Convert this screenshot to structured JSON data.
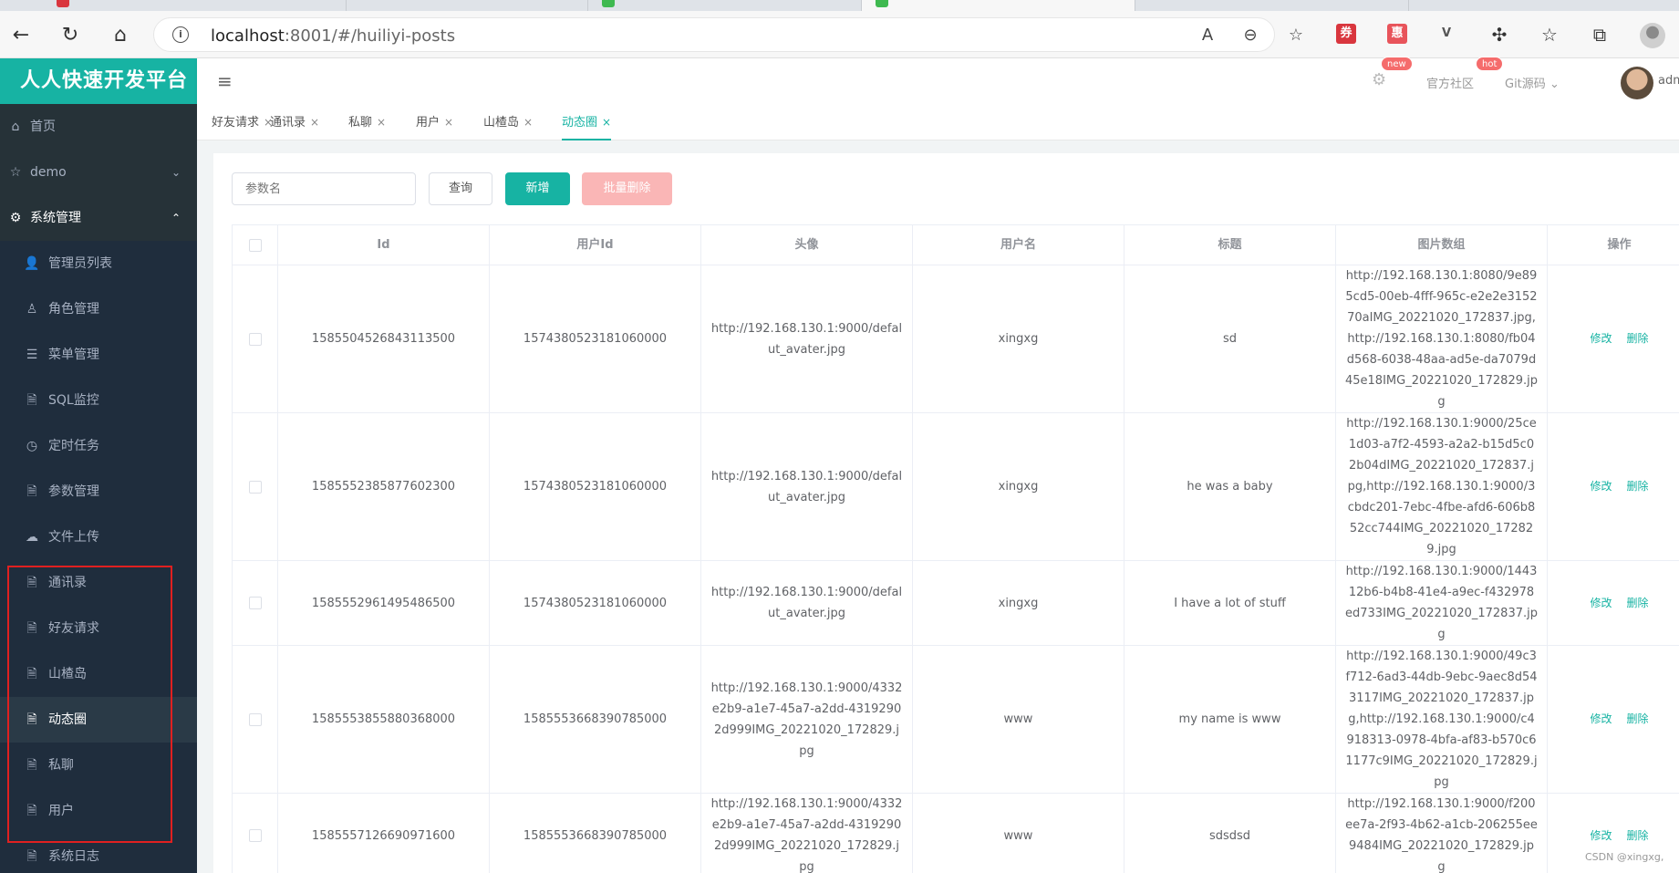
{
  "browser": {
    "url_host": "localhost",
    "url_rest": ":8001/#/huiliyi-posts",
    "read_aloud": "A",
    "ext_icons": [
      "券",
      "惠",
      "V"
    ]
  },
  "sidebar": {
    "brand": "人人快速开发平台",
    "items": [
      {
        "label": "首页",
        "icon": "home-icon",
        "glyph": "⌂"
      },
      {
        "label": "demo",
        "icon": "star-icon",
        "glyph": "☆",
        "arrow": "⌄"
      },
      {
        "label": "系统管理",
        "icon": "gear-icon",
        "glyph": "⚙",
        "arrow": "⌃"
      }
    ],
    "sub_items": [
      {
        "label": "管理员列表",
        "icon": "user-icon",
        "glyph": "👤"
      },
      {
        "label": "角色管理",
        "icon": "role-icon",
        "glyph": "♙"
      },
      {
        "label": "菜单管理",
        "icon": "list-icon",
        "glyph": "☰"
      },
      {
        "label": "SQL监控",
        "icon": "document-icon",
        "glyph": "🗎"
      },
      {
        "label": "定时任务",
        "icon": "clock-icon",
        "glyph": "◷"
      },
      {
        "label": "参数管理",
        "icon": "document-icon",
        "glyph": "🗎"
      },
      {
        "label": "文件上传",
        "icon": "cloud-icon",
        "glyph": "☁"
      },
      {
        "label": "通讯录",
        "icon": "document-icon",
        "glyph": "🗎"
      },
      {
        "label": "好友请求",
        "icon": "document-icon",
        "glyph": "🗎"
      },
      {
        "label": "山楂岛",
        "icon": "document-icon",
        "glyph": "🗎"
      },
      {
        "label": "动态圈",
        "icon": "document-icon",
        "glyph": "🗎",
        "active": true
      },
      {
        "label": "私聊",
        "icon": "document-icon",
        "glyph": "🗎"
      },
      {
        "label": "用户",
        "icon": "document-icon",
        "glyph": "🗎"
      },
      {
        "label": "系统日志",
        "icon": "document-icon",
        "glyph": "🗎"
      }
    ]
  },
  "header": {
    "badge_new": "new",
    "community": "官方社区",
    "badge_hot": "hot",
    "git": "Git源码",
    "username": "adm"
  },
  "tabs": [
    "好友请求",
    "通讯录",
    "私聊",
    "用户",
    "山楂岛",
    "动态圈"
  ],
  "active_tab": "动态圈",
  "toolbar": {
    "search_placeholder": "参数名",
    "query": "查询",
    "add": "新增",
    "batch_delete": "批量删除"
  },
  "table": {
    "columns": [
      "Id",
      "用户Id",
      "头像",
      "用户名",
      "标题",
      "图片数组",
      "操作"
    ],
    "edit": "修改",
    "delete": "删除",
    "rows": [
      {
        "id": "1585504526843113500",
        "user_id": "1574380523181060000",
        "avatar": "http://192.168.130.1:9000/defalut_avater.jpg",
        "username": "xingxg",
        "title": "sd",
        "images": "http://192.168.130.1:8080/9e895cd5-00eb-4fff-965c-e2e2e315270aIMG_20221020_172837.jpg,http://192.168.130.1:8080/fb04d568-6038-48aa-ad5e-da7079d45e18IMG_20221020_172829.jpg"
      },
      {
        "id": "1585552385877602300",
        "user_id": "1574380523181060000",
        "avatar": "http://192.168.130.1:9000/defalut_avater.jpg",
        "username": "xingxg",
        "title": "he was a baby",
        "images": "http://192.168.130.1:9000/25ce1d03-a7f2-4593-a2a2-b15d5c02b04dIMG_20221020_172837.jpg,http://192.168.130.1:9000/3cbdc201-7ebc-4fbe-afd6-606b852cc744IMG_20221020_172829.jpg"
      },
      {
        "id": "1585552961495486500",
        "user_id": "1574380523181060000",
        "avatar": "http://192.168.130.1:9000/defalut_avater.jpg",
        "username": "xingxg",
        "title": "I have a lot of stuff",
        "images": "http://192.168.130.1:9000/144312b6-b4b8-41e4-a9ec-f432978ed733IMG_20221020_172837.jpg"
      },
      {
        "id": "1585553855880368000",
        "user_id": "1585553668390785000",
        "avatar": "http://192.168.130.1:9000/4332e2b9-a1e7-45a7-a2dd-43192902d999IMG_20221020_172829.jpg",
        "username": "www",
        "title": "my name is www",
        "images": "http://192.168.130.1:9000/49c3f712-6ad3-44db-9ebc-9aec8d543117IMG_20221020_172837.jpg,http://192.168.130.1:9000/c4918313-0978-4bfa-af83-b570c61177c9IMG_20221020_172829.jpg"
      },
      {
        "id": "1585557126690971600",
        "user_id": "1585553668390785000",
        "avatar": "http://192.168.130.1:9000/4332e2b9-a1e7-45a7-a2dd-43192902d999IMG_20221020_172829.jpg",
        "username": "www",
        "title": "sdsdsd",
        "images": "http://192.168.130.1:9000/f200ee7a-2f93-4b62-a1cb-206255ee9484IMG_20221020_172829.jpg"
      }
    ]
  },
  "watermark": "CSDN @xingxg,",
  "colors": {
    "accent": "#17b3a3",
    "sidebar_bg": "#263238",
    "danger_light": "#fab6b6",
    "badge": "#f56c6c",
    "highlight_box": "#e02020"
  }
}
